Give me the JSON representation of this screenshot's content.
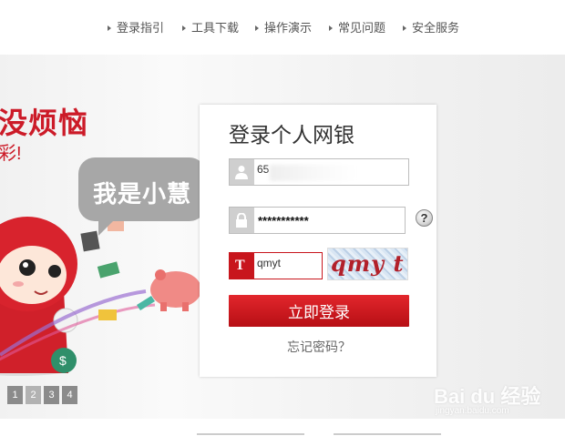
{
  "nav": {
    "items": [
      {
        "label": "登录指引"
      },
      {
        "label": "工具下载"
      },
      {
        "label": "操作演示"
      },
      {
        "label": "常见问题"
      },
      {
        "label": "安全服务"
      }
    ]
  },
  "banner": {
    "slogan": "没烦恼",
    "subline": "彩!",
    "bubble": "我是小慧",
    "pager": [
      "1",
      "2",
      "3",
      "4"
    ],
    "active_page": 1
  },
  "login": {
    "title": "登录个人网银",
    "username_value": "65",
    "password_value": "***********",
    "help_symbol": "?",
    "captcha_letter": "T",
    "captcha_value": "qmyt",
    "captcha_image_text": "qmy t",
    "submit_label": "立即登录",
    "forgot_label": "忘记密码？"
  },
  "watermark": {
    "text": "Bai du 经验",
    "sub": "jingyan.baidu.com"
  },
  "colors": {
    "brand_red": "#cc1b28",
    "button_red": "#c8161d"
  }
}
